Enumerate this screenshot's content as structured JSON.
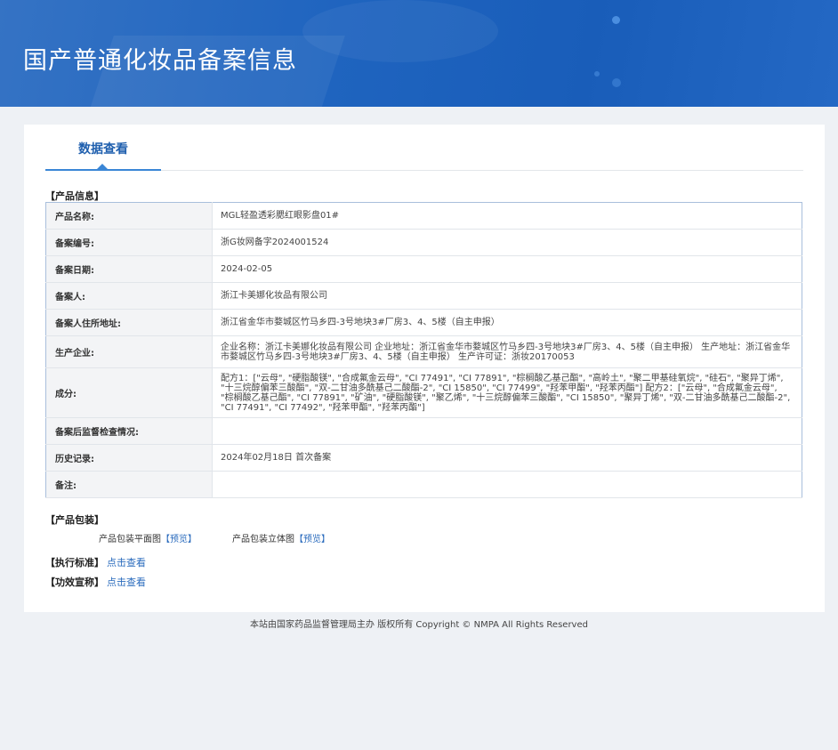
{
  "header": {
    "title": "国产普通化妆品备案信息"
  },
  "tabs": [
    {
      "label": "数据查看",
      "active": true
    }
  ],
  "product_info": {
    "section_label": "【产品信息】",
    "rows": [
      {
        "key": "产品名称:",
        "value": "MGL轻盈透彩腮红眼影盘01#"
      },
      {
        "key": "备案编号:",
        "value": "浙G妆网备字2024001524"
      },
      {
        "key": "备案日期:",
        "value": "2024-02-05"
      },
      {
        "key": "备案人:",
        "value": "浙江卡美娜化妆品有限公司"
      },
      {
        "key": "备案人住所地址:",
        "value": "浙江省金华市婺城区竹马乡四-3号地块3#厂房3、4、5楼（自主申报）"
      },
      {
        "key": "生产企业:",
        "value": "企业名称：浙江卡美娜化妆品有限公司 企业地址：浙江省金华市婺城区竹马乡四-3号地块3#厂房3、4、5楼（自主申报） 生产地址：浙江省金华市婺城区竹马乡四-3号地块3#厂房3、4、5楼（自主申报） 生产许可证：浙妆20170053"
      },
      {
        "key": "成分:",
        "value": "配方1：[\"云母\", \"硬脂酸镁\", \"合成氟金云母\", \"CI 77491\", \"CI 77891\", \"棕榈酸乙基己酯\", \"高岭土\", \"聚二甲基硅氧烷\", \"硅石\", \"聚异丁烯\", \"十三烷醇偏苯三酸酯\", \"双-二甘油多酰基己二酸酯-2\", \"CI 15850\", \"CI 77499\", \"羟苯甲酯\", \"羟苯丙酯\"] 配方2：[\"云母\", \"合成氟金云母\", \"棕榈酸乙基己酯\", \"CI 77891\", \"矿油\", \"硬脂酸镁\", \"聚乙烯\", \"十三烷醇偏苯三酸酯\", \"CI 15850\", \"聚异丁烯\", \"双-二甘油多酰基己二酸酯-2\", \"CI 77491\", \"CI 77492\", \"羟苯甲酯\", \"羟苯丙酯\"]"
      },
      {
        "key": "备案后监督检查情况:",
        "value": ""
      },
      {
        "key": "历史记录:",
        "value": "2024年02月18日 首次备案"
      },
      {
        "key": "备注:",
        "value": ""
      }
    ]
  },
  "packaging": {
    "section_label": "【产品包装】",
    "flat_label": "产品包装平面图",
    "flat_link": "【预览】",
    "solid_label": "产品包装立体图",
    "solid_link": "【预览】"
  },
  "standard": {
    "label": "【执行标准】",
    "link": "点击查看"
  },
  "efficacy": {
    "label": "【功效宣称】",
    "link": "点击查看"
  },
  "footer": {
    "text": "本站由国家药品监督管理局主办 版权所有 Copyright © NMPA All Rights Reserved"
  },
  "colors": {
    "banner": "#1f64bf",
    "accent": "#3a86d6",
    "link": "#2a6bbd",
    "page_bg": "#eef1f5"
  }
}
